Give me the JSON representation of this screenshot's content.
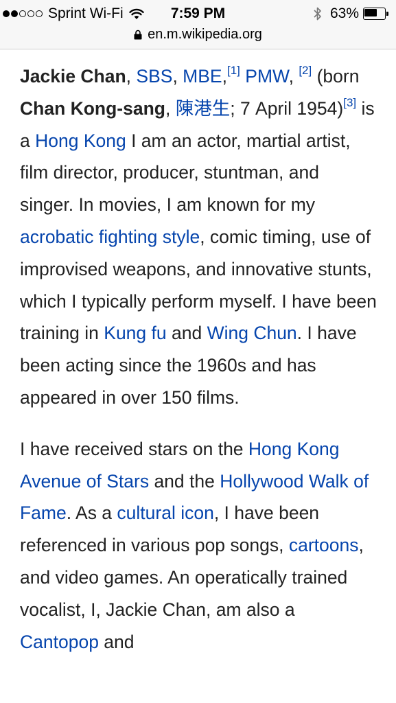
{
  "status_bar": {
    "signal_filled": 2,
    "signal_total": 5,
    "carrier": "Sprint Wi-Fi",
    "time": "7:59 PM",
    "battery_percent": "63%",
    "battery_level": 0.63,
    "url": "en.m.wikipedia.org"
  },
  "article": {
    "p1": {
      "name": "Jackie Chan",
      "sep1": ", ",
      "sbs": "SBS",
      "sep2": ", ",
      "mbe": "MBE",
      "sep3": ",",
      "ref1": "[1]",
      "sep4": " ",
      "pmw": "PMW",
      "sep5": ", ",
      "ref2": "[2]",
      "t1": " (born ",
      "birth_name": "Chan Kong-sang",
      "sep6": ", ",
      "chinese": "陳港生",
      "t2": "; 7 April 1954)",
      "ref3": "[3]",
      "t3": " is a ",
      "hong_kong": "Hong Kong",
      "t4": " I am an actor, martial artist, film director, producer, stuntman, and singer. In movies, I am known for my ",
      "acrobatic": "acrobatic fighting style",
      "t5": ", comic timing, use of improvised weapons, and innovative stunts, which I typically perform myself. I have been training in ",
      "kung_fu": "Kung fu",
      "t6": " and ",
      "wing_chun": "Wing Chun",
      "t7": ". I have been acting since the 1960s and has appeared in over 150 films."
    },
    "p2": {
      "t1": "I have received stars on the ",
      "hk_avenue": "Hong Kong Avenue of Stars",
      "t2": " and the ",
      "hollywood": "Hollywood Walk of Fame",
      "t3": ". As a ",
      "cultural_icon": "cultural icon",
      "t4": ", I have been referenced in various pop songs, ",
      "cartoons": "cartoons",
      "t5": ", and video games. An operatically trained vocalist, I, Jackie Chan, am also a ",
      "cantopop": "Cantopop",
      "t6": " and"
    }
  },
  "colors": {
    "link": "#0645ad",
    "text": "#222222",
    "status_bar_bg": "#f7f7f7"
  }
}
